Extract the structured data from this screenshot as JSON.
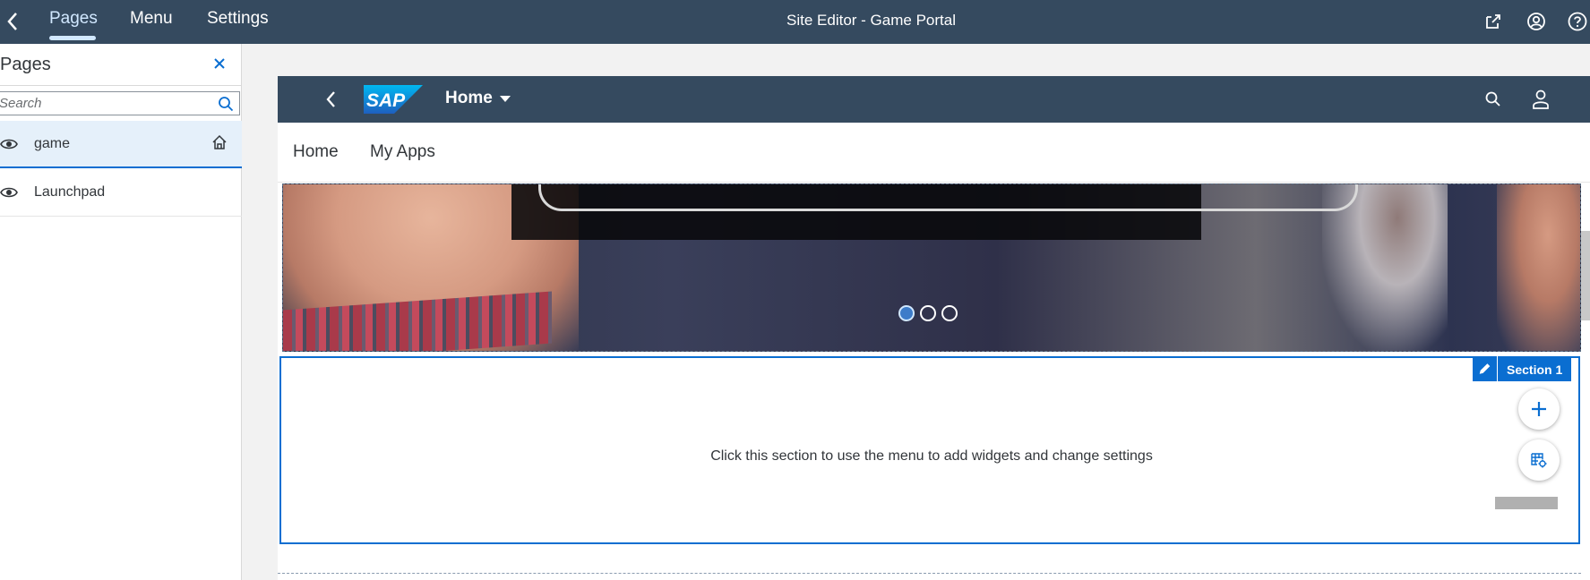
{
  "shell": {
    "tabs": [
      {
        "label": "Pages",
        "active": true
      },
      {
        "label": "Menu",
        "active": false
      },
      {
        "label": "Settings",
        "active": false
      }
    ],
    "title": "Site Editor - Game Portal",
    "icons": [
      "share-icon",
      "user-icon",
      "help-icon"
    ]
  },
  "left_panel": {
    "title": "Pages",
    "search_placeholder": "Search",
    "pages": [
      {
        "label": "game",
        "selected": true,
        "is_home": true
      },
      {
        "label": "Launchpad",
        "selected": false,
        "is_home": false
      }
    ]
  },
  "preview": {
    "logo": "SAP",
    "home_menu": "Home",
    "nav": [
      "Home",
      "My Apps"
    ],
    "carousel": {
      "slides": 3,
      "active_slide": 1
    },
    "section": {
      "tag": "Section 1",
      "hint": "Click this section to use the menu to add widgets and change settings"
    }
  },
  "colors": {
    "shell_bg": "#354a5f",
    "accent": "#0a6ed1",
    "selected_row": "#e5f0fa"
  }
}
